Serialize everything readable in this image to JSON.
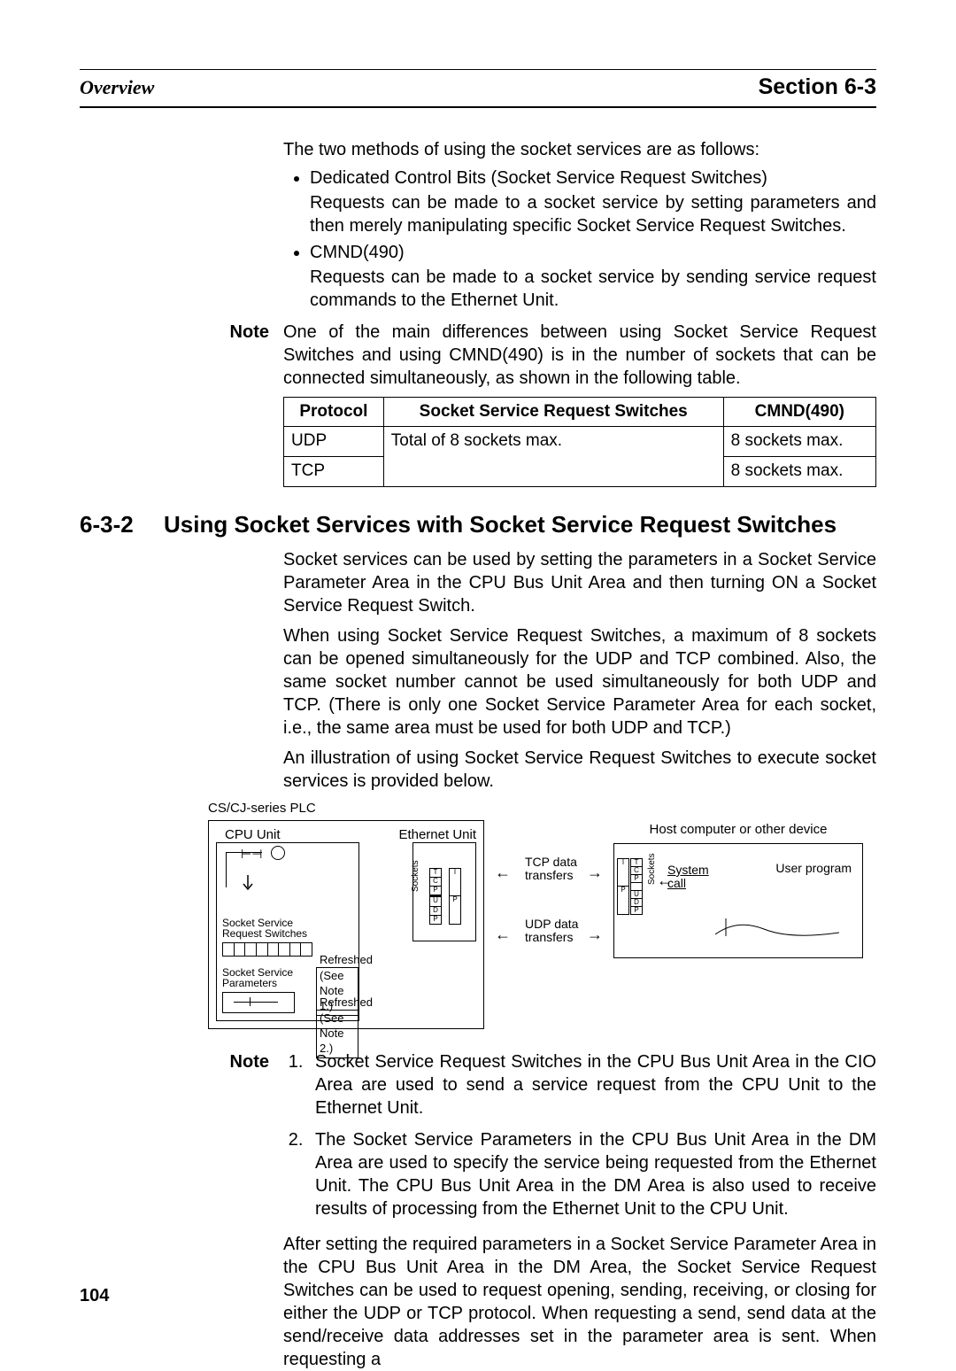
{
  "header": {
    "left": "Overview",
    "right": "Section 6-3"
  },
  "intro": "The two methods of using the socket services are as follows:",
  "bullets": [
    {
      "title": "Dedicated Control Bits (Socket Service Request Switches)",
      "sub": "Requests can be made to a socket service by setting parameters and then merely manipulating specific Socket Service Request Switches."
    },
    {
      "title": "CMND(490)",
      "sub": "Requests can be made to a socket service by sending service request commands to the Ethernet Unit."
    }
  ],
  "note1": {
    "label": "Note",
    "text": "One of the main differences between using Socket Service Request Switches and using CMND(490) is in the number of sockets that can be connected simultaneously, as shown in the following table."
  },
  "table": {
    "headers": [
      "Protocol",
      "Socket Service Request Switches",
      "CMND(490)"
    ],
    "rows": [
      [
        "UDP",
        "Total of 8 sockets max.",
        "8 sockets max."
      ],
      [
        "TCP",
        "",
        "8 sockets max."
      ]
    ],
    "merge_col2_rowspan": 2
  },
  "h2": {
    "num": "6-3-2",
    "title": "Using Socket Services with Socket Service Request Switches"
  },
  "para1": "Socket services can be used by setting the parameters in a Socket Service Parameter Area in the CPU Bus Unit Area and then turning ON a Socket Service Request Switch.",
  "para2": "When using Socket Service Request Switches, a maximum of 8 sockets can be opened simultaneously for the UDP and TCP combined. Also, the same socket number cannot be used simultaneously for both UDP and TCP. (There is only one Socket Service Parameter Area for each socket, i.e., the same area must be used for both UDP and TCP.)",
  "para3": "An illustration of using Socket Service Request Switches to execute socket services is provided below.",
  "diagram": {
    "plc_label": "CS/CJ-series PLC",
    "cpu_label": "CPU Unit",
    "eth_label": "Ethernet Unit",
    "ssr": "Socket Service\nRequest Switches",
    "ssp": "Socket Service\nParameters",
    "refreshed": "Refreshed",
    "see1": "(See Note 1.)",
    "see2": "(See Note 2.)",
    "sockets": "Sockets",
    "tcp_stack": [
      "T",
      "C",
      "P",
      "I",
      "P"
    ],
    "udp_stack": [
      "U",
      "D",
      "P"
    ],
    "tcp_xfer": "TCP data\ntransfers",
    "udp_xfer": "UDP data\ntransfers",
    "host_label": "Host computer or other device",
    "syscall": "System\ncall",
    "userprog": "User program"
  },
  "note2": {
    "label": "Note",
    "items": [
      "Socket Service Request Switches in the CPU Bus Unit Area in the CIO Area are used to send a service request from the CPU Unit to the Ethernet Unit.",
      "The Socket Service Parameters in the CPU Bus Unit Area in the DM Area are used to specify the service being requested from the Ethernet Unit. The CPU Bus Unit Area in the DM Area is also used to receive results of processing from the Ethernet Unit to the CPU Unit."
    ]
  },
  "para4": "After setting the required parameters in a Socket Service Parameter Area in the CPU Bus Unit Area in the DM Area, the Socket Service Request Switches can be used to request opening, sending, receiving, or closing for either the UDP or TCP protocol. When requesting a send, send data at the send/receive data addresses set in the parameter area is sent. When requesting a",
  "pagenum": "104"
}
